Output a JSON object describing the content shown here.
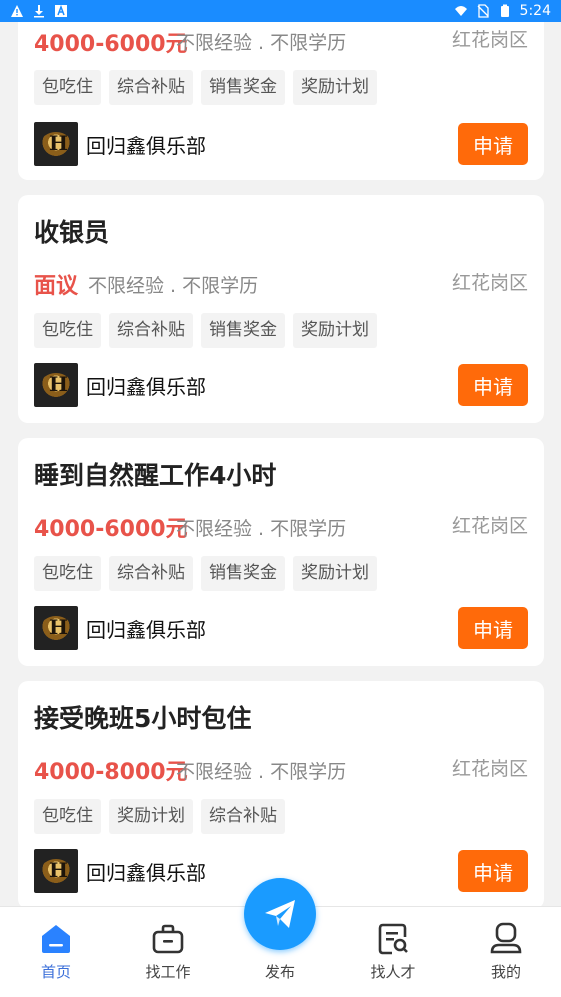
{
  "status_bar": {
    "time": "5:24",
    "icons_left": [
      "warning-icon",
      "download-icon",
      "app-a-icon"
    ],
    "icons_right": [
      "wifi-icon",
      "no-sim-icon",
      "battery-icon"
    ]
  },
  "colors": {
    "salary": "#e8534a",
    "apply_button": "#ff6a0a",
    "tab_active": "#3b6fd9",
    "publish_button": "#1a9bff",
    "status_bar": "#1a8cff"
  },
  "jobs": [
    {
      "title": "",
      "salary": "4000-6000元",
      "requirements": "不限经验 . 不限学历",
      "area": "红花岗区",
      "tags": [
        "包吃住",
        "综合补贴",
        "销售奖金",
        "奖励计划"
      ],
      "company": "回归鑫俱乐部",
      "apply_label": "申请"
    },
    {
      "title": "收银员",
      "salary": "面议",
      "requirements": "不限经验 . 不限学历",
      "area": "红花岗区",
      "tags": [
        "包吃住",
        "综合补贴",
        "销售奖金",
        "奖励计划"
      ],
      "company": "回归鑫俱乐部",
      "apply_label": "申请"
    },
    {
      "title": "睡到自然醒工作4小时",
      "salary": "4000-6000元",
      "requirements": "不限经验 . 不限学历",
      "area": "红花岗区",
      "tags": [
        "包吃住",
        "综合补贴",
        "销售奖金",
        "奖励计划"
      ],
      "company": "回归鑫俱乐部",
      "apply_label": "申请"
    },
    {
      "title": "接受晚班5小时包住",
      "salary": "4000-8000元",
      "requirements": "不限经验 . 不限学历",
      "area": "红花岗区",
      "tags": [
        "包吃住",
        "奖励计划",
        "综合补贴"
      ],
      "company": "回归鑫俱乐部",
      "apply_label": "申请"
    }
  ],
  "tab_bar": {
    "home": "首页",
    "find_job": "找工作",
    "publish": "发布",
    "find_talent": "找人才",
    "mine": "我的",
    "active": "home"
  }
}
